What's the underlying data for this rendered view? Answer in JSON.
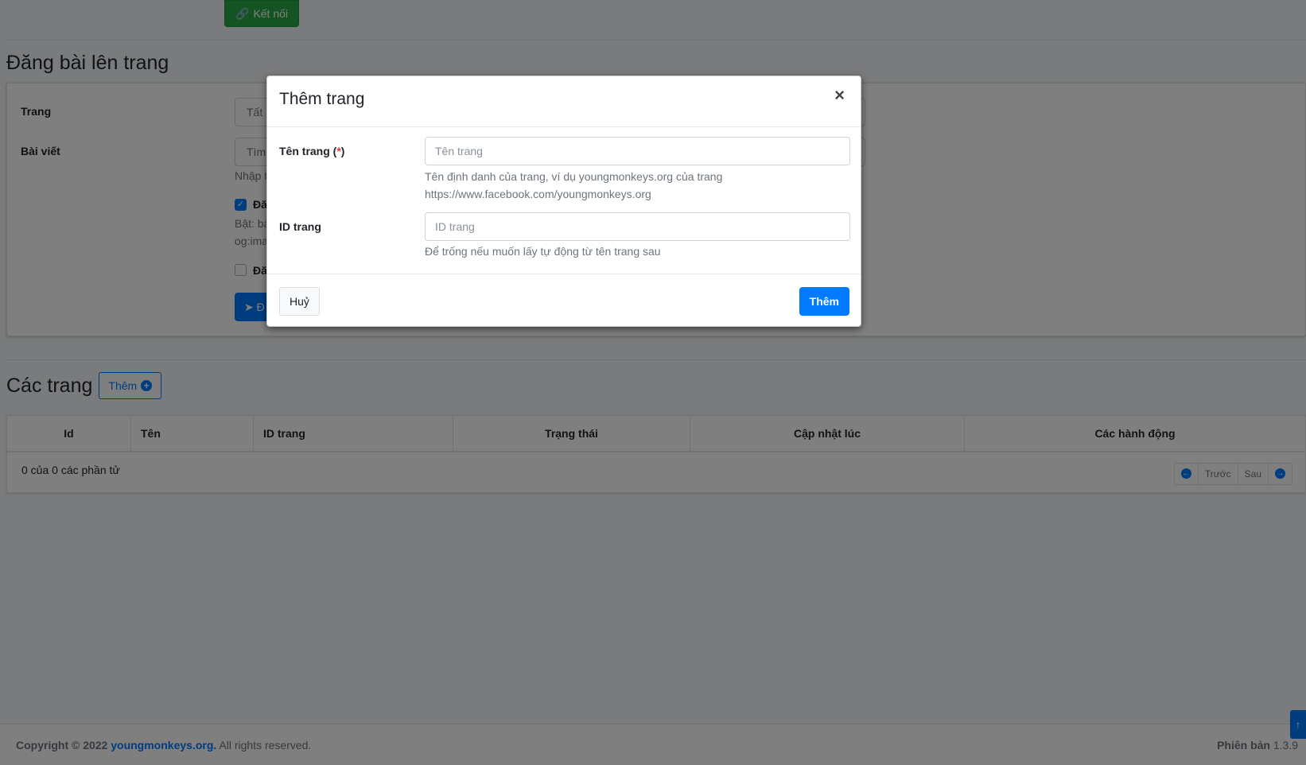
{
  "connect_button": {
    "label": "Kết nối",
    "icon": "link-icon"
  },
  "post_section": {
    "title": "Đăng bài lên trang",
    "page_label": "Trang",
    "page_select_value": "Tất",
    "post_label": "Bài viết",
    "post_search_placeholder": "Tìm",
    "post_help": "Nhập t",
    "option1_label": "Đă",
    "option1_help_line1": "Bật: bả",
    "option1_help_line2": "og:ima",
    "option2_label": "Đă",
    "post_button_label": "Đ"
  },
  "pages_section": {
    "title": "Các trang",
    "add_button_label": "Thêm",
    "columns": [
      "Id",
      "Tên",
      "ID trang",
      "Trạng thái",
      "Cập nhật lúc",
      "Các hành động"
    ],
    "info": "0 của 0 các phần tử",
    "pager": {
      "prev_label": "Trước",
      "next_label": "Sau"
    }
  },
  "footer": {
    "copyright_prefix": "Copyright © 2022",
    "link_text": "youngmonkeys.org.",
    "copyright_suffix": "All rights reserved.",
    "version_label": "Phiên bản",
    "version_value": "1.3.9"
  },
  "modal": {
    "title": "Thêm trang",
    "close_symbol": "×",
    "name_label": "Tên trang (",
    "name_required_mark": "*",
    "name_label_close": ")",
    "name_placeholder": "Tên trang",
    "name_help_line1": "Tên định danh của trang, ví dụ youngmonkeys.org của trang",
    "name_help_line2": "https://www.facebook.com/youngmonkeys.org",
    "id_label": "ID trang",
    "id_placeholder": "ID trang",
    "id_help": "Để trống nếu muốn lấy tự động từ tên trang sau",
    "cancel_label": "Huỷ",
    "submit_label": "Thêm"
  },
  "colors": {
    "primary": "#007bff",
    "success": "#28a745",
    "danger": "#dc3545"
  }
}
